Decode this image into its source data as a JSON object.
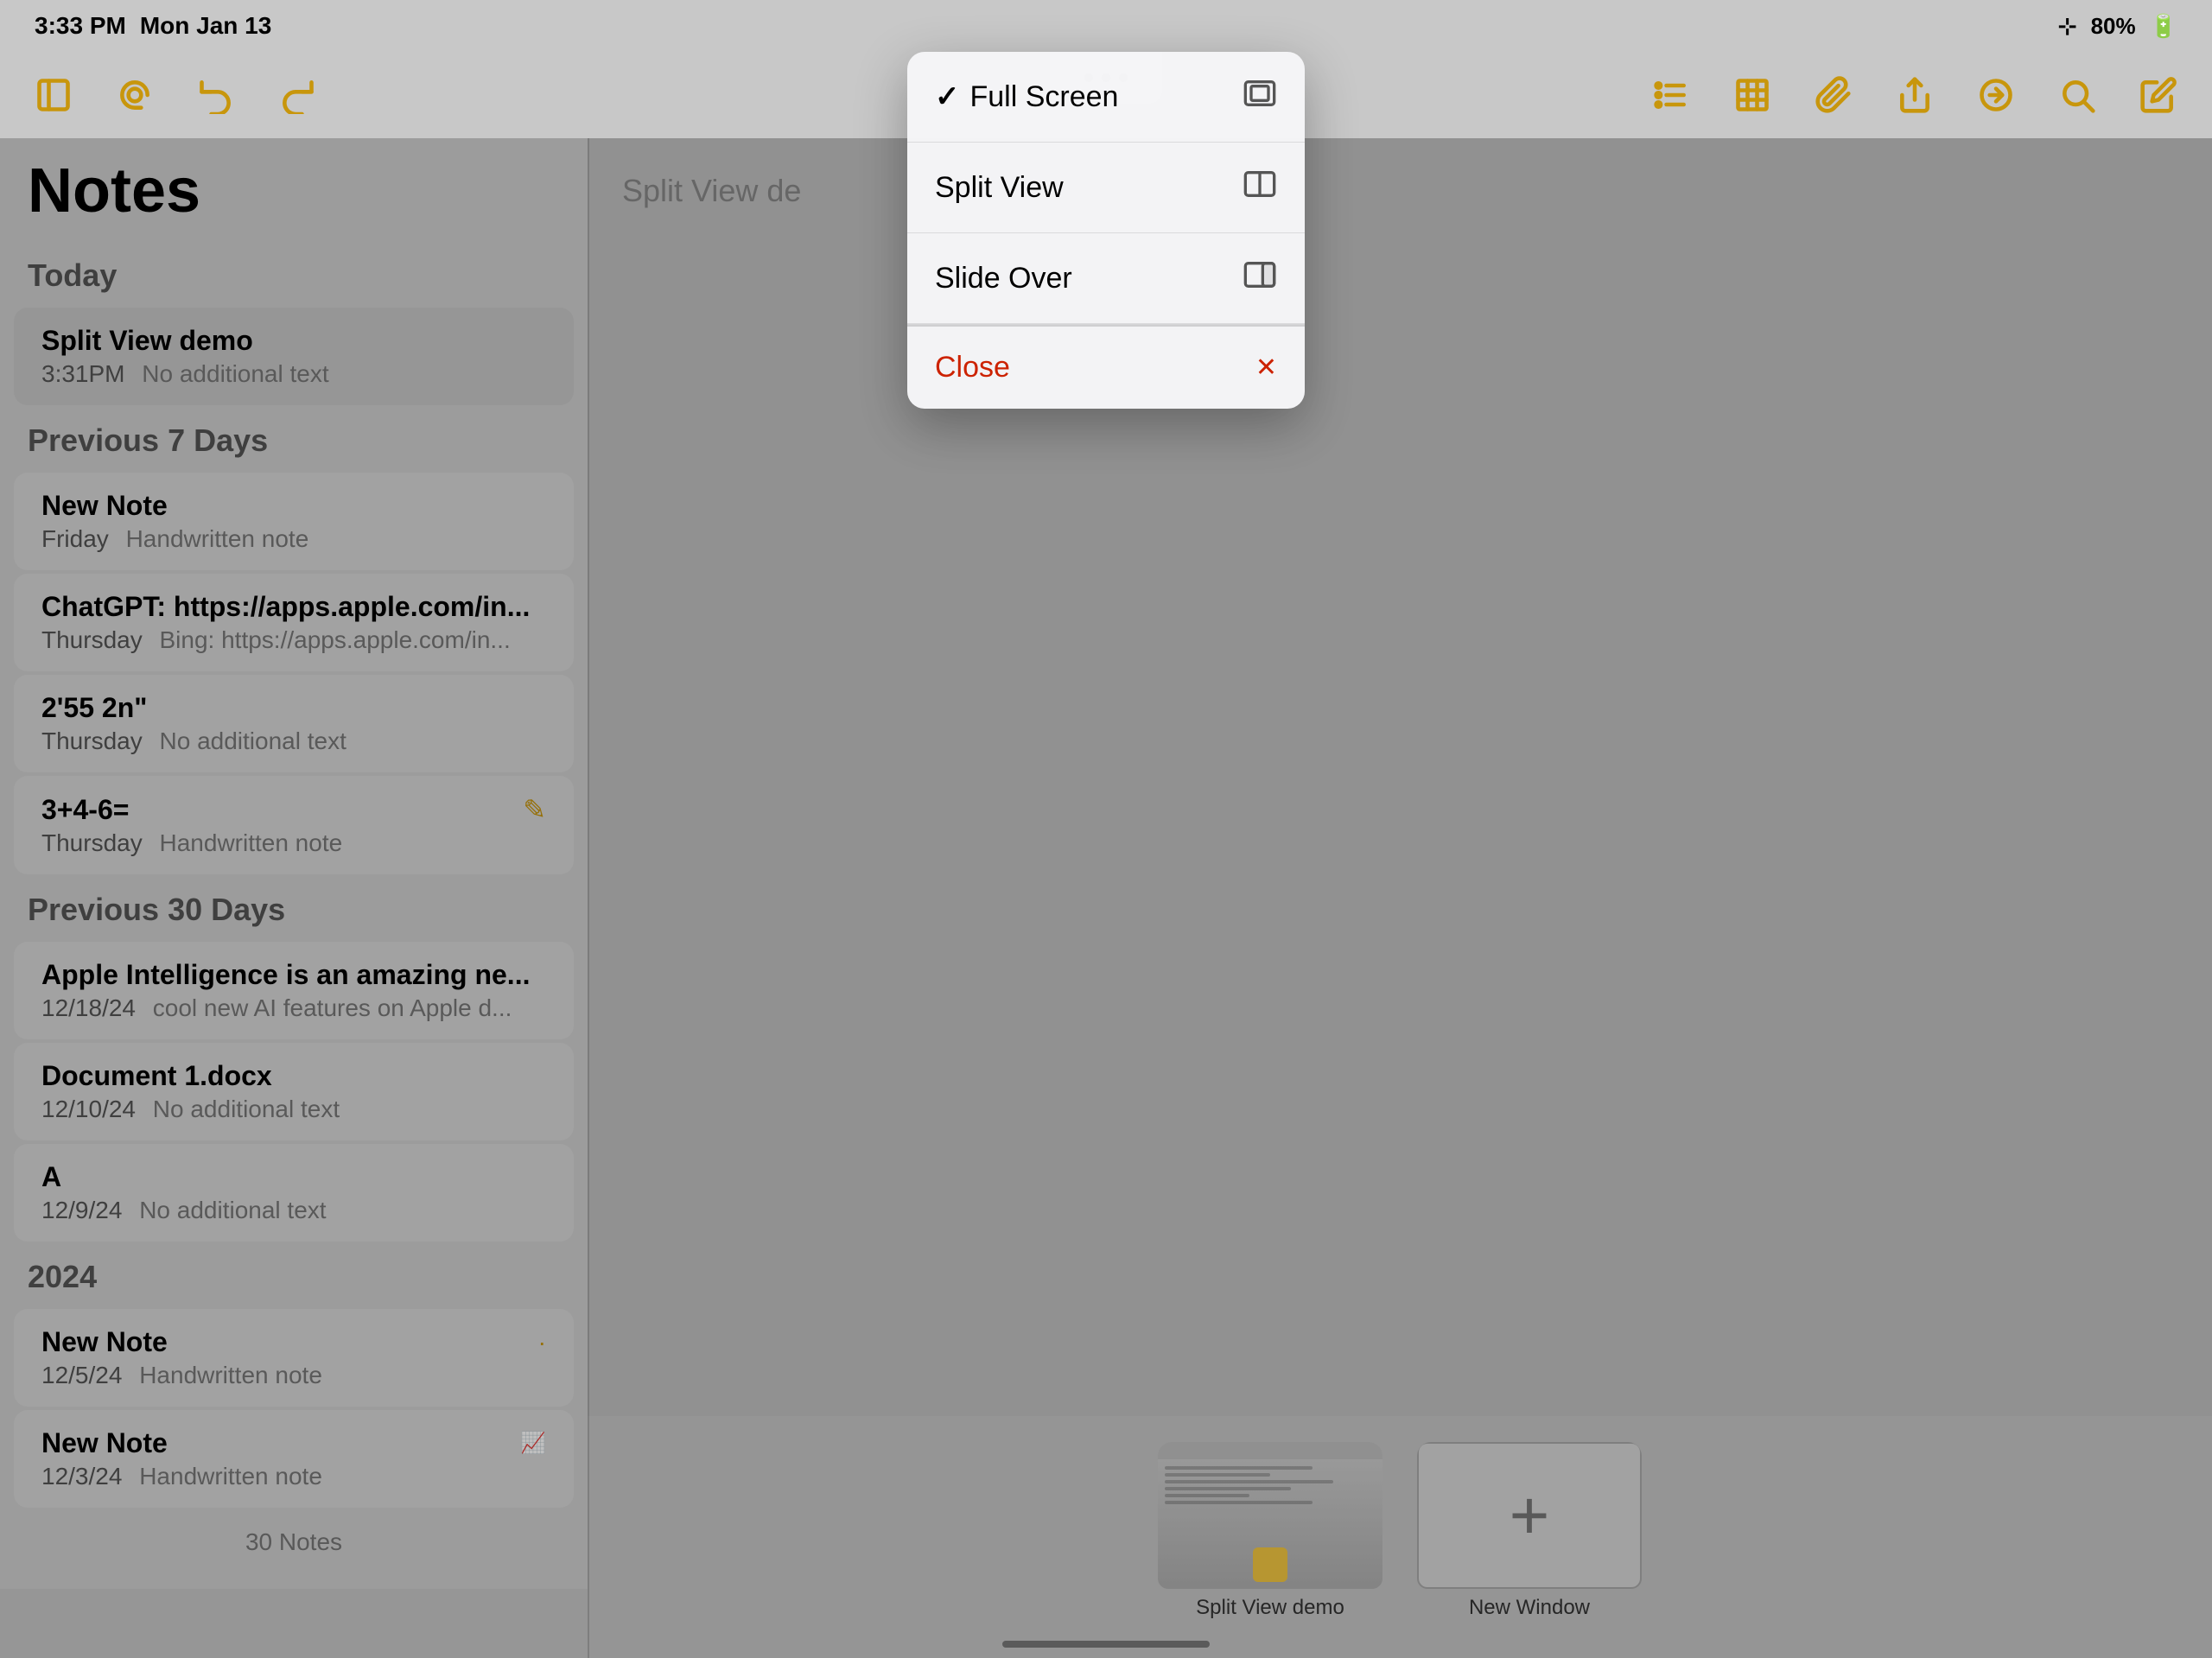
{
  "status_bar": {
    "time": "3:33 PM",
    "date": "Mon Jan 13",
    "wifi": "WiFi",
    "battery": "80%"
  },
  "toolbar": {
    "sidebar_toggle_label": "sidebar",
    "mention_label": "mention",
    "undo_label": "undo",
    "redo_label": "redo",
    "three_dots_label": "more options",
    "checklist_label": "checklist",
    "table_label": "table",
    "attachment_label": "attachment",
    "share_label": "share",
    "markup_label": "markup",
    "search_label": "search",
    "compose_label": "compose"
  },
  "sidebar": {
    "title": "Notes",
    "sections": [
      {
        "header": "Today",
        "notes": [
          {
            "title": "Split View demo",
            "date": "3:31PM",
            "subtitle": "No additional text",
            "active": true
          }
        ]
      },
      {
        "header": "Previous 7 Days",
        "notes": [
          {
            "title": "New Note",
            "date": "Friday",
            "subtitle": "Handwritten note",
            "handwritten": true
          },
          {
            "title": "ChatGPT: https://apps.apple.com/in...",
            "date": "Thursday",
            "subtitle": "Bing: https://apps.apple.com/in..."
          },
          {
            "title": "2'55 2n\"",
            "date": "Thursday",
            "subtitle": "No additional text"
          },
          {
            "title": "3+4-6=",
            "date": "Thursday",
            "subtitle": "Handwritten note",
            "handwritten": true
          }
        ]
      },
      {
        "header": "Previous 30 Days",
        "notes": [
          {
            "title": "Apple Intelligence is an amazing ne...",
            "date": "12/18/24",
            "subtitle": "cool new AI features on Apple d..."
          },
          {
            "title": "Document 1.docx",
            "date": "12/10/24",
            "subtitle": "No additional text"
          },
          {
            "title": "A",
            "date": "12/9/24",
            "subtitle": "No additional text"
          }
        ]
      },
      {
        "header": "2024",
        "notes": [
          {
            "title": "New Note",
            "date": "12/5/24",
            "subtitle": "Handwritten note",
            "handwritten": true
          },
          {
            "title": "New Note",
            "date": "12/3/24",
            "subtitle": "Handwritten note",
            "handwritten": true
          }
        ]
      }
    ],
    "note_count": "30 Notes"
  },
  "main_content": {
    "header_text": "Split View de"
  },
  "dropdown_menu": {
    "items": [
      {
        "label": "Full Screen",
        "checked": true,
        "icon": "fullscreen-icon"
      },
      {
        "label": "Split View",
        "checked": false,
        "icon": "splitview-icon"
      },
      {
        "label": "Slide Over",
        "checked": false,
        "icon": "slideover-icon"
      },
      {
        "label": "Close",
        "checked": false,
        "icon": "close-icon",
        "is_close": true
      }
    ]
  },
  "multitask_bar": {
    "windows": [
      {
        "label": "Split View demo",
        "type": "existing"
      },
      {
        "label": "New Window",
        "type": "new"
      }
    ]
  },
  "home_indicator": "home"
}
